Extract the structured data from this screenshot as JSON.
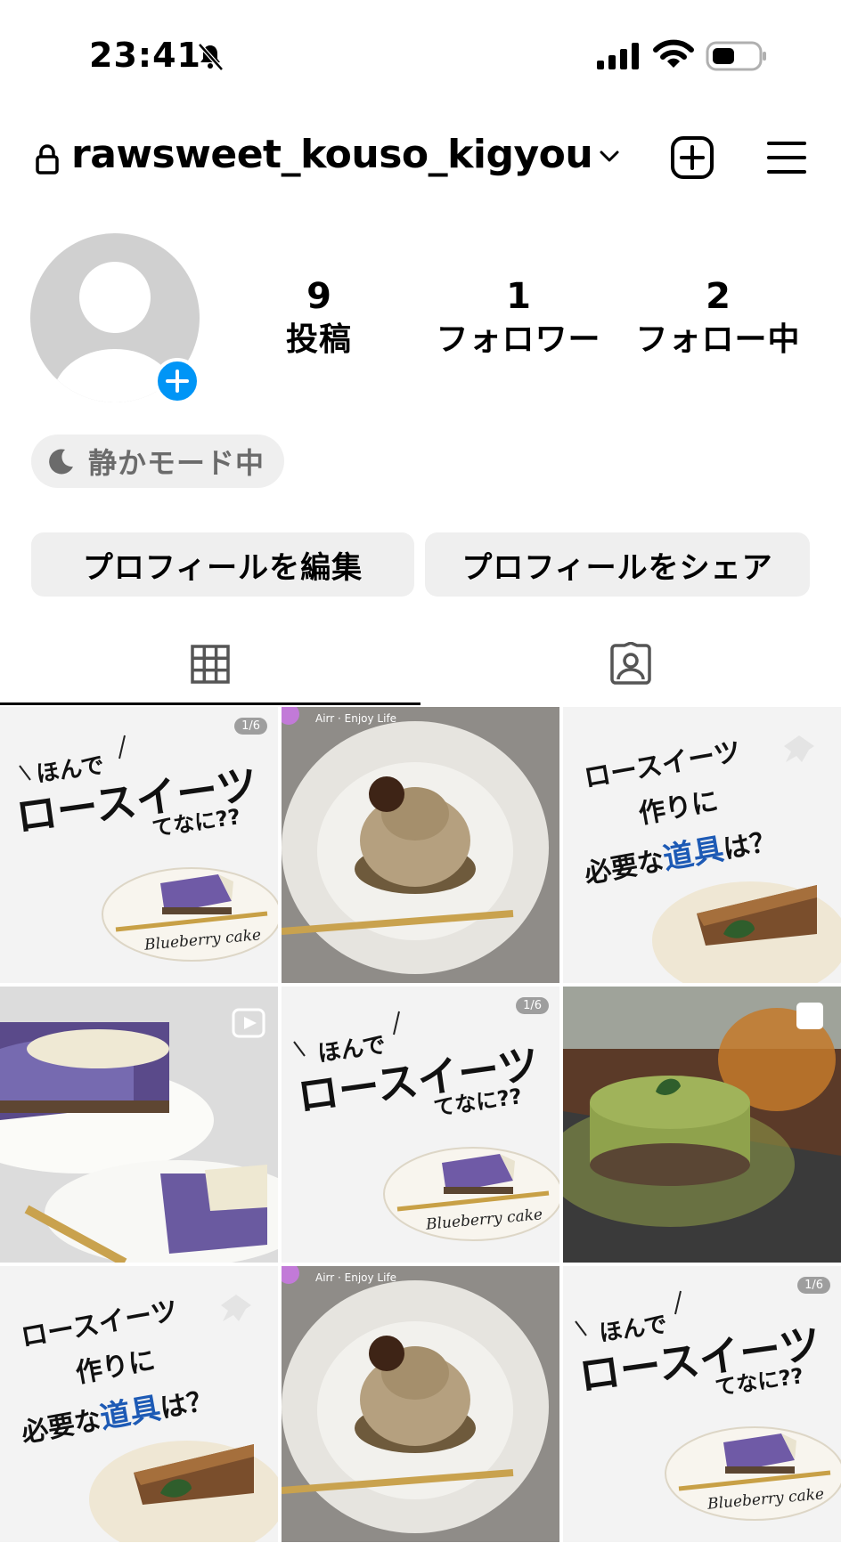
{
  "status_bar": {
    "time": "23:41"
  },
  "header": {
    "username": "rawsweet_kouso_kigyou"
  },
  "profile": {
    "stats": [
      {
        "value": "9",
        "label": "投稿"
      },
      {
        "value": "1",
        "label": "フォロワー"
      },
      {
        "value": "2",
        "label": "フォロー中"
      }
    ],
    "quiet_mode_label": "静かモード中",
    "edit_button": "プロフィールを編集",
    "share_button": "プロフィールをシェア"
  },
  "tabs": [
    {
      "name": "grid-icon",
      "active": true
    },
    {
      "name": "tagged-icon",
      "active": false
    }
  ],
  "posts": [
    {
      "type": "carousel",
      "count": "1/6",
      "line1": "ほんで",
      "line2": "ロースイーツ",
      "line3": "てなに??",
      "caption": "Blueberry cake"
    },
    {
      "type": "reel",
      "sub": "Airr · Enjoy Life"
    },
    {
      "type": "pinned",
      "line1": "ロースイーツ",
      "line2": "作りに",
      "line3a": "必要な",
      "line3b": "道具",
      "line3c": "は？"
    },
    {
      "type": "reel"
    },
    {
      "type": "carousel",
      "count": "1/6",
      "line1": "ほんで",
      "line2": "ロースイーツ",
      "line3": "てなに??",
      "caption": "Blueberry cake"
    },
    {
      "type": "carousel"
    },
    {
      "type": "pinned",
      "line1": "ロースイーツ",
      "line2": "作りに",
      "line3a": "必要な",
      "line3b": "道具",
      "line3c": "は？"
    },
    {
      "type": "reel",
      "sub": "Airr · Enjoy Life"
    },
    {
      "type": "carousel",
      "count": "1/6",
      "line1": "ほんで",
      "line2": "ロースイーツ",
      "line3": "てなに??",
      "caption": "Blueberry cake"
    }
  ],
  "colors": {
    "accent": "#0095f6",
    "highlight_blue": "#1d5ab5"
  }
}
